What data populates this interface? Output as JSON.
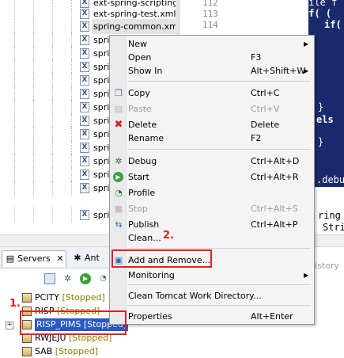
{
  "tree": {
    "files": [
      {
        "name": "ext-spring-scripting",
        "selected": false
      },
      {
        "name": "ext-spring-test.xml",
        "selected": false
      },
      {
        "name": "spring-common.xml",
        "selected": true
      },
      {
        "name": "spri",
        "selected": false
      },
      {
        "name": "spri",
        "selected": false
      },
      {
        "name": "spri",
        "selected": false
      },
      {
        "name": "spri",
        "selected": false
      },
      {
        "name": "spri",
        "selected": false
      },
      {
        "name": "spri",
        "selected": false
      },
      {
        "name": "spri",
        "selected": false
      },
      {
        "name": "spri",
        "selected": false
      },
      {
        "name": "spri",
        "selected": false
      },
      {
        "name": "spri",
        "selected": false
      },
      {
        "name": "spri",
        "selected": false
      },
      {
        "name": "spri",
        "selected": false
      },
      {
        "name": "spri",
        "selected": false
      }
    ],
    "xml_glyph": "X"
  },
  "editor": {
    "line_numbers": [
      "112",
      "113",
      "114"
    ],
    "code_lines": [
      "File f",
      "if( (",
      "if(",
      "}",
      "els",
      "}",
      ".debu",
      "ring",
      "Stri"
    ]
  },
  "servers_panel": {
    "tabs": [
      {
        "label": "Servers",
        "icon": "servers-icon",
        "active": true
      },
      {
        "label": "Ant",
        "icon": "ant-icon",
        "active": false
      }
    ],
    "close_glyph": "✕",
    "servers": [
      {
        "name": "PCITY",
        "status": "[Stopped]"
      },
      {
        "name": "RISP",
        "status": "[Stopped]"
      },
      {
        "name": "RISP_PIMS",
        "status": "[Stopped]",
        "selected": true
      },
      {
        "name": "RWJEJU",
        "status": "[Stopped]"
      },
      {
        "name": "SAB",
        "status": "[Stopped]"
      }
    ],
    "history_label": "listory"
  },
  "context_menu": {
    "items": [
      {
        "label": "New",
        "shortcut": "",
        "submenu": true,
        "enabled": true,
        "icon": ""
      },
      {
        "label": "Open",
        "shortcut": "F3",
        "submenu": false,
        "enabled": true,
        "icon": ""
      },
      {
        "label": "Show In",
        "shortcut": "Alt+Shift+W",
        "submenu": true,
        "enabled": true,
        "icon": ""
      },
      {
        "label": "Copy",
        "shortcut": "Ctrl+C",
        "submenu": false,
        "enabled": true,
        "icon": "copy-icon"
      },
      {
        "label": "Paste",
        "shortcut": "Ctrl+V",
        "submenu": false,
        "enabled": false,
        "icon": "paste-icon"
      },
      {
        "label": "Delete",
        "shortcut": "Delete",
        "submenu": false,
        "enabled": true,
        "icon": "delete-icon"
      },
      {
        "label": "Rename",
        "shortcut": "F2",
        "submenu": false,
        "enabled": true,
        "icon": ""
      },
      {
        "label": "Debug",
        "shortcut": "Ctrl+Alt+D",
        "submenu": false,
        "enabled": true,
        "icon": "debug-icon"
      },
      {
        "label": "Start",
        "shortcut": "Ctrl+Alt+R",
        "submenu": false,
        "enabled": true,
        "icon": "start-icon"
      },
      {
        "label": "Profile",
        "shortcut": "",
        "submenu": false,
        "enabled": true,
        "icon": "profile-icon"
      },
      {
        "label": "Stop",
        "shortcut": "Ctrl+Alt+S",
        "submenu": false,
        "enabled": false,
        "icon": "stop-icon"
      },
      {
        "label": "Publish",
        "shortcut": "Ctrl+Alt+P",
        "submenu": false,
        "enabled": true,
        "icon": "publish-icon"
      },
      {
        "label": "Clean...",
        "shortcut": "",
        "submenu": false,
        "enabled": true,
        "icon": ""
      },
      {
        "label": "Add and Remove...",
        "shortcut": "",
        "submenu": false,
        "enabled": true,
        "icon": "add-remove-icon"
      },
      {
        "label": "Monitoring",
        "shortcut": "",
        "submenu": true,
        "enabled": true,
        "icon": ""
      },
      {
        "label": "Clean Tomcat Work Directory...",
        "shortcut": "",
        "submenu": false,
        "enabled": true,
        "icon": ""
      },
      {
        "label": "Properties",
        "shortcut": "Alt+Enter",
        "submenu": false,
        "enabled": true,
        "icon": ""
      }
    ],
    "submenu_glyph": "▶"
  },
  "annotations": {
    "step1": "1.",
    "step2": "2."
  },
  "colors": {
    "annotation_red": "#e02020",
    "selection_blue": "#2b58c4",
    "editor_dark": "#1a2a6c",
    "stopped_status": "#8a7c00"
  }
}
